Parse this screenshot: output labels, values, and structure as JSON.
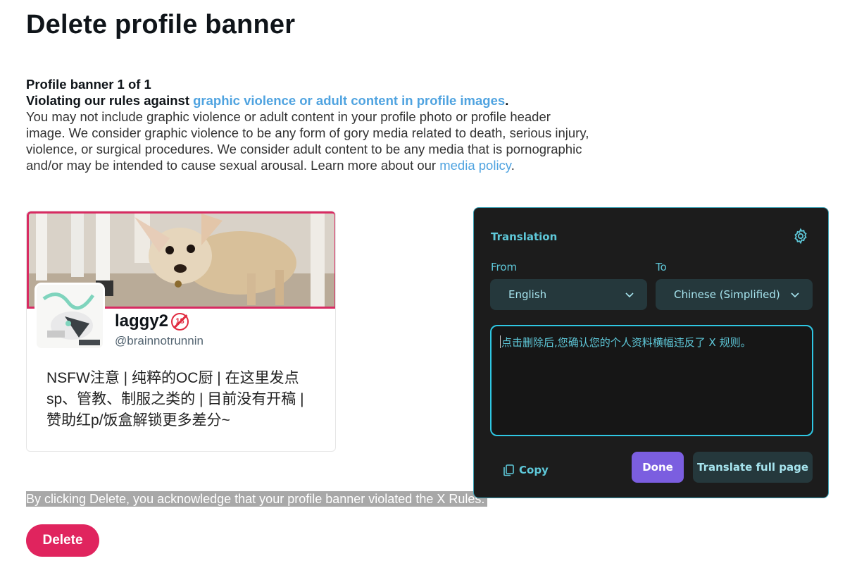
{
  "page": {
    "title": "Delete profile banner",
    "counter": "Profile banner 1 of 1",
    "violation_prefix": "Violating our rules against ",
    "violation_link": "graphic violence or adult content in profile images",
    "violation_suffix": ".",
    "description": "You may not include graphic violence or adult content in your profile photo or profile header image. We consider graphic violence to be any form of gory media related to death, serious injury, violence, or surgical procedures. We consider adult content to be any media that is pornographic and/or may be intended to cause sexual arousal. Learn more about our ",
    "media_policy_link": "media policy",
    "description_end": ".",
    "acknowledgement": "By clicking Delete, you acknowledge that your profile banner violated the X Rules.",
    "delete_label": "Delete"
  },
  "profile": {
    "display_name": "laggy2",
    "badge_text": "18",
    "handle": "@brainnotrunnin",
    "bio": "NSFW注意 | 纯粹的OC厨 | 在这里发点sp、管教、制服之类的 | 目前没有开稿 | 赞助红p/饭盒解锁更多差分~"
  },
  "translation": {
    "title": "Translation",
    "from_label": "From",
    "to_label": "To",
    "from_value": "English",
    "to_value": "Chinese (Simplified)",
    "output": "点击删除后,您确认您的个人资料横幅违反了 X 规则。",
    "copy_label": "Copy",
    "done_label": "Done",
    "translate_page_label": "Translate full page"
  },
  "colors": {
    "accent_link": "#4fa3e0",
    "delete_button": "#e0245e",
    "panel_accent": "#5ec8d9",
    "done_button": "#7b5ee0"
  },
  "icons": [
    "gear-icon",
    "chevron-down-icon",
    "copy-icon",
    "nsfw-18-icon"
  ]
}
